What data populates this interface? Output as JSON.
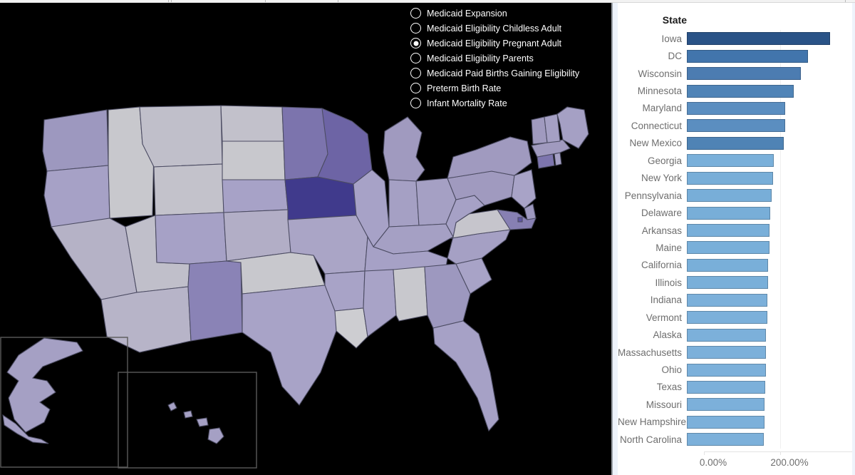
{
  "legend": {
    "name": "measure-selector",
    "selected": "Medicaid Eligibility Pregnant Adult",
    "items": [
      {
        "label": "Medicaid Expansion",
        "selected": false
      },
      {
        "label": "Medicaid Eligibility Childless Adult",
        "selected": false
      },
      {
        "label": "Medicaid Eligibility Pregnant Adult",
        "selected": true
      },
      {
        "label": "Medicaid Eligibility Parents",
        "selected": false
      },
      {
        "label": "Medicaid Paid Births Gaining Eligibility",
        "selected": false
      },
      {
        "label": "Preterm Birth Rate",
        "selected": false
      },
      {
        "label": "Infant Mortality Rate",
        "selected": false
      }
    ]
  },
  "map": {
    "background": "#000000",
    "border_color": "#4c4c63",
    "insets": [
      "Alaska",
      "Hawaii"
    ],
    "color_scale": {
      "low": "#cccccf",
      "mid": "#a5a0c4",
      "high": "#3f3a8c"
    },
    "state_values": {
      "IA": 375,
      "WI": 306,
      "MN": 283,
      "MD": 264,
      "CT": 264,
      "NM": 255,
      "GA": 225,
      "NY": 223,
      "PA": 220,
      "DE": 217,
      "AR": 214,
      "ME": 214,
      "CA": 213,
      "IL": 213,
      "IN": 213,
      "VT": 213,
      "AK": 205,
      "MA": 205,
      "OH": 205,
      "TX": 203,
      "MO": 201,
      "NH": 201,
      "NC": 201,
      "WA": 198,
      "OR": 190,
      "NV": 165,
      "AZ": 161,
      "UT": 144,
      "CO": 195,
      "MT": 162,
      "ID": 138,
      "WY": 154,
      "ND": 157,
      "SD": 138,
      "NE": 194,
      "KS": 171,
      "OK": 138,
      "MI": 195,
      "VA": 148,
      "WV": 190,
      "KY": 195,
      "TN": 195,
      "MS": 194,
      "AL": 141,
      "LA": 133,
      "FL": 191,
      "SC": 194,
      "NJ": 194,
      "RI": 190,
      "HI": 191
    }
  },
  "chart_data": {
    "type": "bar",
    "orientation": "horizontal",
    "title": "",
    "xlabel": "",
    "ylabel": "State",
    "header": "State",
    "xlim": [
      0,
      640
    ],
    "xticks": [
      0,
      200
    ],
    "xtick_labels": [
      "0.00%",
      "200.00%"
    ],
    "grid": true,
    "legend": "none",
    "value_format": "percent",
    "categories": [
      "Iowa",
      "DC",
      "Wisconsin",
      "Minnesota",
      "Maryland",
      "Connecticut",
      "New Mexico",
      "Georgia",
      "New York",
      "Pennsylvania",
      "Delaware",
      "Arkansas",
      "Maine",
      "California",
      "Illinois",
      "Indiana",
      "Vermont",
      "Alaska",
      "Massachusetts",
      "Ohio",
      "Texas",
      "Missouri",
      "New Hampshire",
      "North Carolina"
    ],
    "values": [
      375,
      317,
      299,
      280,
      258,
      258,
      254,
      228,
      226,
      222,
      219,
      216,
      216,
      214,
      214,
      212,
      212,
      207,
      207,
      207,
      205,
      203,
      203,
      201
    ],
    "bar_colors": [
      "#2a5387",
      "#4275ac",
      "#4c7cb1",
      "#5084b7",
      "#5b8ec0",
      "#5b8ec0",
      "#4f83b5",
      "#7ab0da",
      "#78aed8",
      "#78aed8",
      "#78aed8",
      "#79afd9",
      "#79afd9",
      "#79afd9",
      "#79afd9",
      "#7cb0da",
      "#7cb0da",
      "#7cb0da",
      "#7cb0da",
      "#7cb0da",
      "#7cb0da",
      "#7cb0da",
      "#7cb0da",
      "#7cb0da"
    ]
  },
  "colors": {
    "panel_gutter": "#eef3fb",
    "chart_background": "#ffffff",
    "axis_text": "#6e6e6e",
    "header_text": "#1b1b1b",
    "gridline": "#f0f0f0"
  }
}
